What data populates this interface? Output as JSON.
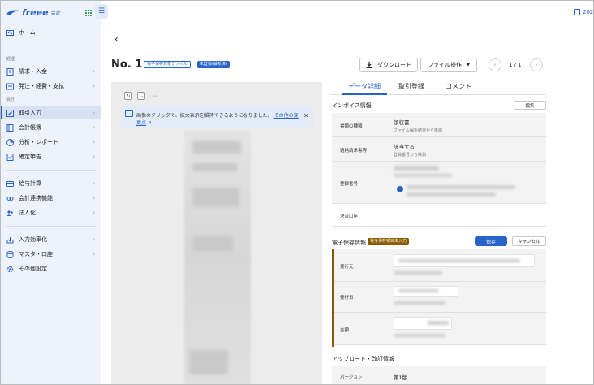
{
  "app": {
    "logo_text": "freee",
    "logo_sub": "会計",
    "top_right_text": "202"
  },
  "sidebar": {
    "home": "ホーム",
    "section_keiri": "経理",
    "section_kaikei": "会計",
    "items": [
      {
        "label": "請求・入金"
      },
      {
        "label": "発注・経費・支払"
      },
      {
        "label": "取引入力"
      },
      {
        "label": "会計帳簿"
      },
      {
        "label": "分析・レポート"
      },
      {
        "label": "確定申告"
      },
      {
        "label": "給与計算"
      },
      {
        "label": "会計連携機能"
      },
      {
        "label": "法人化"
      },
      {
        "label": "入力効率化"
      },
      {
        "label": "マスタ・口座"
      },
      {
        "label": "その他設定"
      }
    ]
  },
  "header": {
    "title": "No. 1",
    "tag_file": "電子保存対象ファイル",
    "tag_status": "未登録(解析済)",
    "download_label": "ダウンロード",
    "file_ops_label": "ファイル操作",
    "pager": "1 / 1"
  },
  "viewer": {
    "info_text": "画像のクリックで、拡大表示を維持できるようになりました。",
    "info_link": "その他の変更点"
  },
  "tabs": [
    "データ詳細",
    "取引登録",
    "コメント"
  ],
  "invoice": {
    "title": "インボイス情報",
    "edit_label": "編集",
    "rows": [
      {
        "label": "書類の種類",
        "value": "領収書",
        "sub": "ファイル解析結果から推測"
      },
      {
        "label": "適格請求書等",
        "value": "該当する",
        "sub": "登録番号から推測"
      },
      {
        "label": "登録番号",
        "value": "",
        "sub": ""
      },
      {
        "label": "決済口座",
        "value": "",
        "sub": ""
      }
    ]
  },
  "estorage": {
    "title": "電子保存情報",
    "badge": "電子保存項目未入力",
    "save_label": "保存",
    "cancel_label": "キャンセル",
    "rows": [
      {
        "label": "発行元"
      },
      {
        "label": "発行日"
      },
      {
        "label": "金額"
      }
    ]
  },
  "upload": {
    "title": "アップロード・改訂情報",
    "version_label": "バージョン",
    "version_value": "第1版"
  }
}
